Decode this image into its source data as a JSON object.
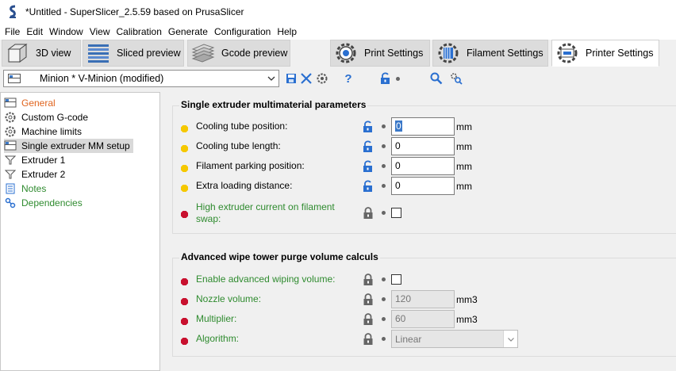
{
  "window": {
    "title": "*Untitled - SuperSlicer_2.5.59  based on PrusaSlicer"
  },
  "menu": [
    "File",
    "Edit",
    "Window",
    "View",
    "Calibration",
    "Generate",
    "Configuration",
    "Help"
  ],
  "tabs": [
    {
      "label": "3D view",
      "icon": "cube-icon",
      "active": false
    },
    {
      "label": "Sliced preview",
      "icon": "layers-icon",
      "active": false
    },
    {
      "label": "Gcode preview",
      "icon": "gcode-layers-icon",
      "active": false
    },
    {
      "label": "Print Settings",
      "icon": "cog-icon",
      "active": false
    },
    {
      "label": "Filament Settings",
      "icon": "spool-icon",
      "active": false
    },
    {
      "label": "Printer Settings",
      "icon": "printer-icon",
      "active": true
    }
  ],
  "preset": {
    "name": "Minion * V-Minion (modified)"
  },
  "toolbar": {
    "icons": [
      "save-icon",
      "delete-icon",
      "compare-icon",
      "help-icon",
      "lock-icon",
      "search-icon",
      "settings-search-icon"
    ],
    "help_label": "?"
  },
  "tree": {
    "items": [
      {
        "label": "General",
        "icon": "window-icon",
        "color": "#e0641e",
        "selected": false
      },
      {
        "label": "Custom G-code",
        "icon": "cog-icon",
        "color": "#000000",
        "selected": false
      },
      {
        "label": "Machine limits",
        "icon": "cog-icon",
        "color": "#000000",
        "selected": false
      },
      {
        "label": "Single extruder MM setup",
        "icon": "window-icon",
        "color": "#000000",
        "selected": true
      },
      {
        "label": "Extruder 1",
        "icon": "funnel-icon",
        "color": "#000000",
        "selected": false
      },
      {
        "label": "Extruder 2",
        "icon": "funnel-icon",
        "color": "#000000",
        "selected": false
      },
      {
        "label": "Notes",
        "icon": "notes-icon",
        "color": "#2f8b2f",
        "selected": false
      },
      {
        "label": "Dependencies",
        "icon": "dependencies-icon",
        "color": "#2f8b2f",
        "selected": false
      }
    ]
  },
  "groups": [
    {
      "title": "Single extruder multimaterial parameters",
      "rows": [
        {
          "label": "Cooling tube position:",
          "dot": "#f5c800",
          "label_color": "#000000",
          "lock": "open",
          "type": "number",
          "value": "0",
          "unit": "mm"
        },
        {
          "label": "Cooling tube length:",
          "dot": "#f5c800",
          "label_color": "#000000",
          "lock": "open",
          "type": "number",
          "value": "0",
          "unit": "mm"
        },
        {
          "label": "Filament parking position:",
          "dot": "#f5c800",
          "label_color": "#000000",
          "lock": "open",
          "type": "number",
          "value": "0",
          "unit": "mm"
        },
        {
          "label": "Extra loading distance:",
          "dot": "#f5c800",
          "label_color": "#000000",
          "lock": "open",
          "type": "number",
          "value": "0",
          "unit": "mm"
        },
        {
          "label": "High extruder current on filament swap:",
          "dot": "#c8102e",
          "label_color": "#2f8b2f",
          "lock": "closed",
          "type": "checkbox",
          "checked": false
        }
      ]
    },
    {
      "title": "Advanced wipe tower purge volume calculs",
      "rows": [
        {
          "label": "Enable advanced wiping volume:",
          "dot": "#c8102e",
          "label_color": "#2f8b2f",
          "lock": "closed",
          "type": "checkbox",
          "checked": false
        },
        {
          "label": "Nozzle volume:",
          "dot": "#c8102e",
          "label_color": "#2f8b2f",
          "lock": "closed",
          "type": "number",
          "value": "120",
          "unit": "mm3",
          "disabled": true
        },
        {
          "label": "Multiplier:",
          "dot": "#c8102e",
          "label_color": "#2f8b2f",
          "lock": "closed",
          "type": "number",
          "value": "60",
          "unit": "mm3",
          "disabled": true
        },
        {
          "label": "Algorithm:",
          "dot": "#c8102e",
          "label_color": "#2f8b2f",
          "lock": "closed",
          "type": "select",
          "value": "Linear",
          "disabled": true
        }
      ]
    }
  ]
}
